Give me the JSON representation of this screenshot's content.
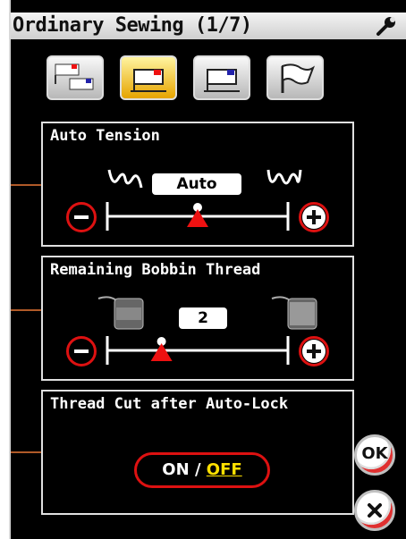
{
  "title": "Ordinary Sewing (1/7)",
  "icons": {
    "wrench": "wrench-icon"
  },
  "toolbar": [
    {
      "icon": "general-settings-icon",
      "active": false
    },
    {
      "icon": "sewing-settings-icon",
      "active": true
    },
    {
      "icon": "machine-settings-icon",
      "active": false
    },
    {
      "icon": "flag-icon",
      "active": false
    }
  ],
  "auto_tension": {
    "title": "Auto Tension",
    "value": "Auto",
    "level": 0.5,
    "minus_icon": "minus-icon",
    "plus_icon": "plus-icon"
  },
  "bobbin": {
    "title": "Remaining Bobbin Thread",
    "value": "2",
    "level": 0.3,
    "minus_icon": "minus-icon",
    "plus_icon": "plus-icon"
  },
  "thread_cut": {
    "title": "Thread Cut after Auto-Lock",
    "on_label": "ON",
    "separator": "/",
    "off_label": "OFF",
    "selected": "OFF"
  },
  "buttons": {
    "ok_label": "OK",
    "cancel_icon": "close-icon"
  },
  "colors": {
    "accent_red": "#dd1111",
    "active_tab": "#f0b400",
    "selected_text": "#ffe000"
  }
}
